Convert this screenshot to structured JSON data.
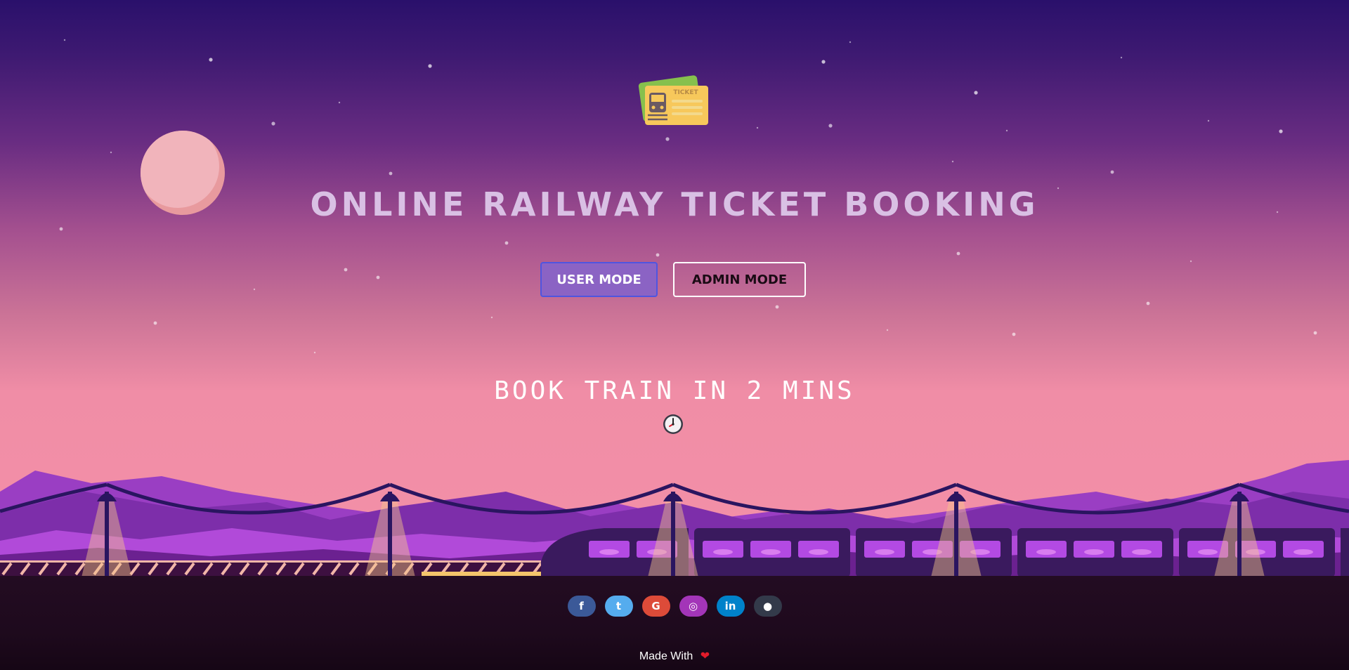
{
  "page": {
    "title": "ONLINE RAILWAY TICKET BOOKING",
    "tagline": "BOOK TRAIN IN 2 MINS"
  },
  "logo": {
    "label": "TICKET",
    "icon": "ticket-icon"
  },
  "buttons": {
    "user_mode": "USER MODE",
    "admin_mode": "ADMIN MODE"
  },
  "clock_icon": "clock-icon",
  "social": [
    {
      "name": "facebook",
      "glyph": "f",
      "color": "#3b5998"
    },
    {
      "name": "twitter",
      "glyph": "t",
      "color": "#55acee"
    },
    {
      "name": "google",
      "glyph": "G",
      "color": "#dd4b39"
    },
    {
      "name": "instagram",
      "glyph": "◎",
      "color": "#a335b8"
    },
    {
      "name": "linkedin",
      "glyph": "in",
      "color": "#0082ca"
    },
    {
      "name": "github",
      "glyph": "●",
      "color": "#333a4a"
    }
  ],
  "footer": {
    "made_with": "Made With",
    "heart": "❤"
  },
  "colors": {
    "title": "#d9c0e4",
    "user_button_bg": "#8b63c4",
    "user_button_border": "#4f55e0",
    "admin_button_border": "#ffffff",
    "heart": "#e21b2a"
  }
}
